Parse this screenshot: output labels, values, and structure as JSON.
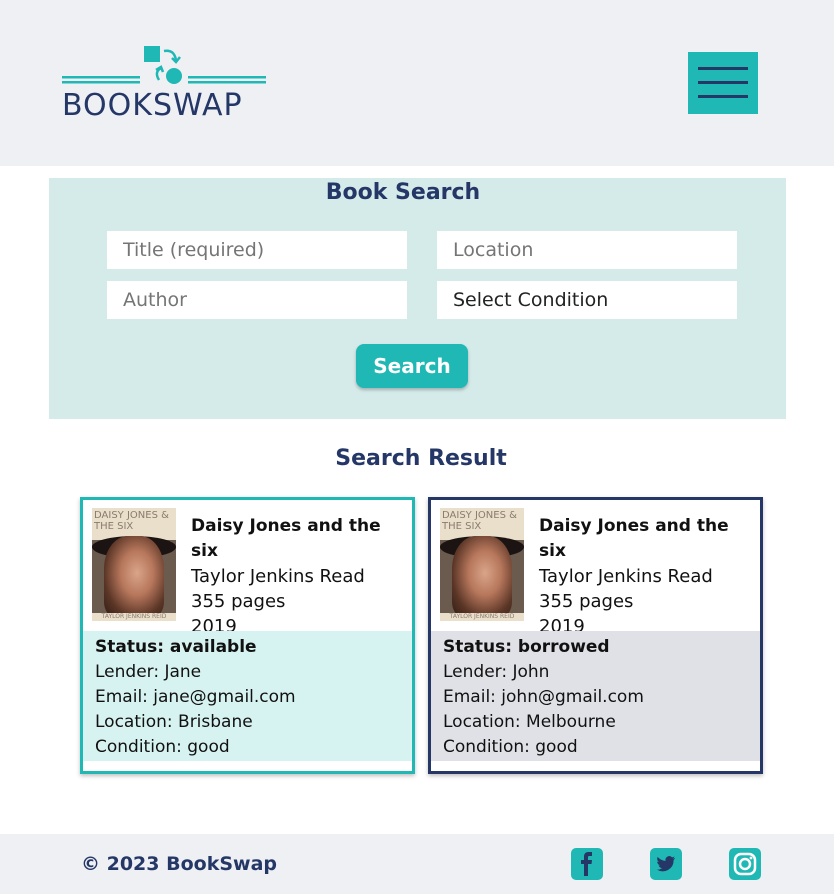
{
  "header": {
    "logo_text": "BOOKSWAP",
    "menu_icon": "hamburger-icon"
  },
  "search": {
    "title": "Book Search",
    "title_placeholder": "Title (required)",
    "location_placeholder": "Location",
    "author_placeholder": "Author",
    "condition_placeholder": "Select Condition",
    "button_label": "Search"
  },
  "results": {
    "title": "Search Result",
    "items": [
      {
        "cover_title": "DAISY JONES & THE SIX",
        "cover_author": "TAYLOR JENKINS REID",
        "title": "Daisy Jones and the six",
        "author": "Taylor Jenkins Read",
        "pages": "355 pages",
        "year": "2019",
        "status": "Status: available",
        "lender": "Lender: Jane",
        "email": "Email: jane@gmail.com",
        "location": "Location: Brisbane",
        "condition": "Condition: good"
      },
      {
        "cover_title": "DAISY JONES & THE SIX",
        "cover_author": "TAYLOR JENKINS REID",
        "title": "Daisy Jones and the six",
        "author": "Taylor Jenkins Read",
        "pages": "355 pages",
        "year": "2019",
        "status": "Status: borrowed",
        "lender": "Lender: John",
        "email": "Email: john@gmail.com",
        "location": "Location: Melbourne",
        "condition": "Condition: good"
      }
    ]
  },
  "footer": {
    "copyright": "© 2023 BookSwap",
    "icons": [
      "facebook-icon",
      "twitter-icon",
      "instagram-icon"
    ]
  },
  "colors": {
    "accent": "#1fb8b4",
    "navy": "#243766",
    "panel": "#d5ebea",
    "available_bg": "#d7f3f1",
    "borrowed_bg": "#dfe1e6"
  }
}
